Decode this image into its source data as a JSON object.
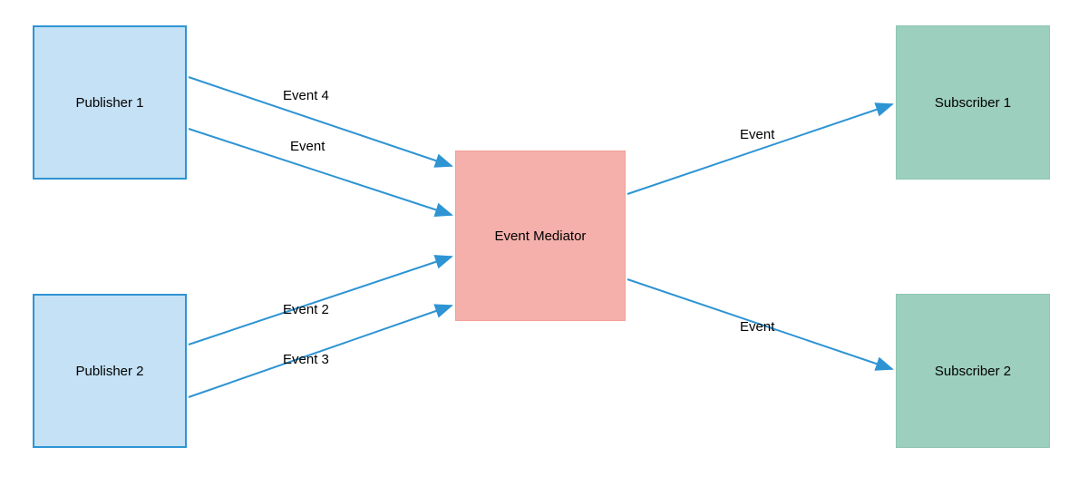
{
  "nodes": {
    "publisher1": {
      "label": "Publisher 1"
    },
    "publisher2": {
      "label": "Publisher 2"
    },
    "mediator": {
      "label": "Event Mediator"
    },
    "subscriber1": {
      "label": "Subscriber 1"
    },
    "subscriber2": {
      "label": "Subscriber 2"
    }
  },
  "edges": {
    "p1_top": {
      "label": "Event 4"
    },
    "p1_bottom": {
      "label": "Event"
    },
    "p2_top": {
      "label": "Event 2"
    },
    "p2_bottom": {
      "label": "Event 3"
    },
    "m_s1": {
      "label": "Event"
    },
    "m_s2": {
      "label": "Event"
    }
  },
  "colors": {
    "publisher_fill": "#c4e1f5",
    "publisher_border": "#2e94d3",
    "mediator_fill": "#f5b0ab",
    "subscriber_fill": "#9dcfbe",
    "arrow": "#2e94d3"
  }
}
